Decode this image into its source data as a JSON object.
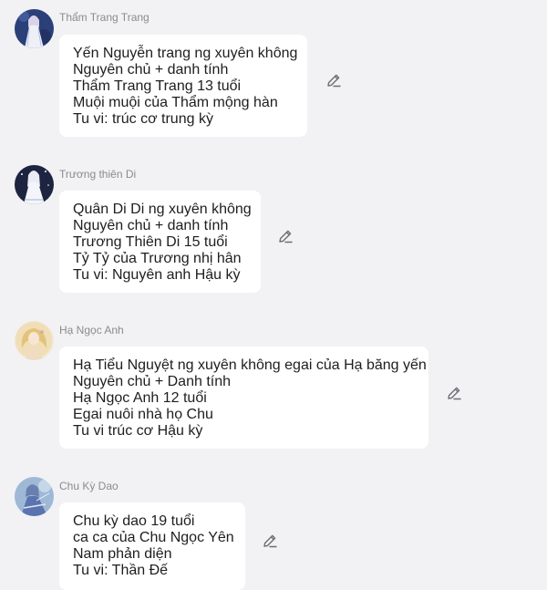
{
  "messages": [
    {
      "sender": "Thẩm Trang Trang",
      "avatar": "avatar-white-dress-character",
      "lines": [
        "Yến Nguyễn trang ng xuyên không",
        "Nguyên chủ + danh tính",
        "Thẩm Trang Trang 13 tuổi",
        "Muội muội của Thẩm mộng hàn",
        "Tu vi: trúc cơ trung kỳ"
      ]
    },
    {
      "sender": "Trương thiên Di",
      "avatar": "avatar-white-robe-character",
      "lines": [
        "Quân Di Di ng xuyên không",
        "Nguyên chủ + danh tính",
        "Trương Thiên Di 15 tuổi",
        "Tỷ Tỷ của Trương nhị hân",
        "Tu vi: Nguyên anh Hậu kỳ"
      ]
    },
    {
      "sender": "Hạ Ngọc Anh",
      "avatar": "avatar-golden-hair-character",
      "lines": [
        "Hạ Tiểu Nguyệt ng xuyên không egai của Hạ băng yến",
        "Nguyên chủ + Danh tính",
        "Hạ Ngọc Anh 12 tuổi",
        "Egai nuôi nhà họ Chu",
        "Tu vi trúc cơ Hậu kỳ"
      ]
    },
    {
      "sender": "Chu Kỳ Dao",
      "avatar": "avatar-blue-robe-character",
      "lines": [
        "Chu kỳ dao 19 tuổi",
        "ca ca của Chu Ngọc Yên",
        "Nam phản diện",
        "Tu vi: Thần Đế"
      ]
    }
  ],
  "icons": {
    "edit": "pencil-edit-icon"
  }
}
